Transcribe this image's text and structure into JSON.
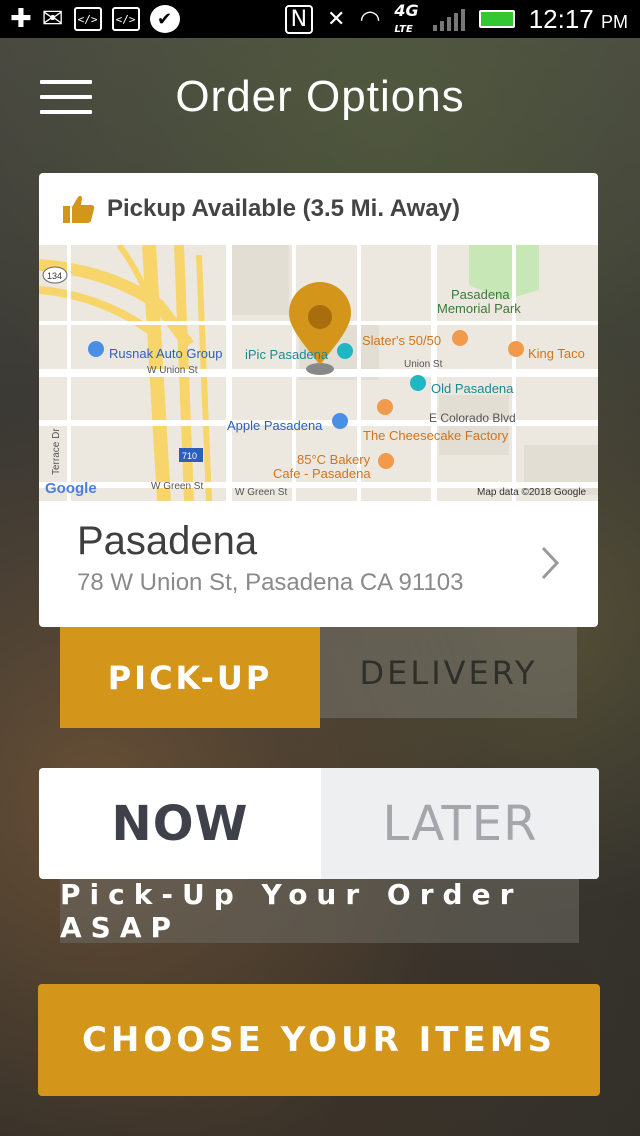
{
  "status_bar": {
    "time": "12:17",
    "ampm": "PM",
    "network": "4G",
    "network_sub": "LTE"
  },
  "header": {
    "title": "Order Options"
  },
  "pickup_card": {
    "status_text": "Pickup Available (3.5 Mi. Away)",
    "location_name": "Pasadena",
    "address": "78 W Union St, Pasadena CA 91103"
  },
  "map": {
    "labels": {
      "park": "Pasadena",
      "park2": "Memorial Park",
      "rusnak": "Rusnak Auto Group",
      "ipic": "iPic Pasadena",
      "slaters": "Slater's 50/50",
      "kingtaco": "King Taco",
      "union1": "W Union St",
      "union2": "Union St",
      "oldpas": "Old Pasadena",
      "colorado": "E Colorado Blvd",
      "apple": "Apple Pasadena",
      "cheesecake": "The Cheesecake Factory",
      "bakery1": "85°C Bakery",
      "bakery2": "Cafe - Pasadena",
      "green1": "W Green St",
      "green2": "W Green St",
      "terrace": "Terrace Dr",
      "route134": "134",
      "route710": "710",
      "google": "Google",
      "mapdata": "Map data ©2018 Google"
    },
    "colors": {
      "land": "#ece8e0",
      "freeway": "#f7d56a",
      "road": "#ffffff",
      "park": "#c7e8b6",
      "pin": "#d4951b",
      "poi_orange": "#f19a4c",
      "poi_blue": "#4a8ee6",
      "poi_teal": "#20b6c4"
    }
  },
  "order_type": {
    "pickup": "PICK-UP",
    "delivery": "DELIVERY",
    "selected": "pickup"
  },
  "timing": {
    "now": "NOW",
    "later": "LATER",
    "selected": "now",
    "note": "Pick-Up Your Order ASAP"
  },
  "cta": {
    "label": "CHOOSE YOUR ITEMS"
  },
  "colors": {
    "accent": "#d4951b",
    "card": "#ffffff",
    "text_dark": "#3e4149",
    "text_muted": "#8a8a8a"
  }
}
